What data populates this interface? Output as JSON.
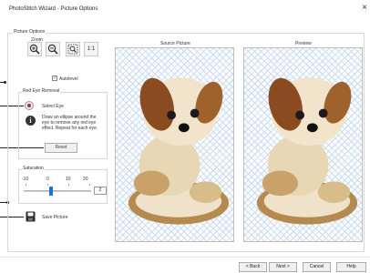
{
  "window": {
    "title": "PhotoStitch Wizard - Picture Options",
    "close_glyph": "×"
  },
  "picture_options": {
    "group_label": "Picture Options",
    "zoom": {
      "label": "Zoom",
      "buttons": [
        "zoom-in-icon",
        "zoom-out-icon",
        "zoom-fit-icon"
      ],
      "actual_size_label": "1:1"
    },
    "autolevel": {
      "label": "Autolevel",
      "checked": true,
      "check_glyph": "✓"
    },
    "red_eye": {
      "title": "Red Eye Removal",
      "select_eye_label": "Select Eye",
      "instructions": "Draw an ellipse around the eye to remove any red eye effect. Repeat for each eye.",
      "reset_label": "Reset"
    },
    "saturation": {
      "title": "Saturation",
      "scale_labels": [
        "-10",
        "0",
        "10",
        "20"
      ],
      "value": "2",
      "min": -10,
      "max": 20
    },
    "save_picture_label": "Save Picture",
    "source_title": "Source Picture",
    "preview_title": "Preview"
  },
  "buttons": {
    "back": "< Back",
    "next": "Next >",
    "cancel": "Cancel",
    "help": "Help"
  },
  "colors": {
    "slider_accent": "#1e6fcf",
    "red_eye": "#c0262d",
    "checker": "#c9dcf2"
  }
}
